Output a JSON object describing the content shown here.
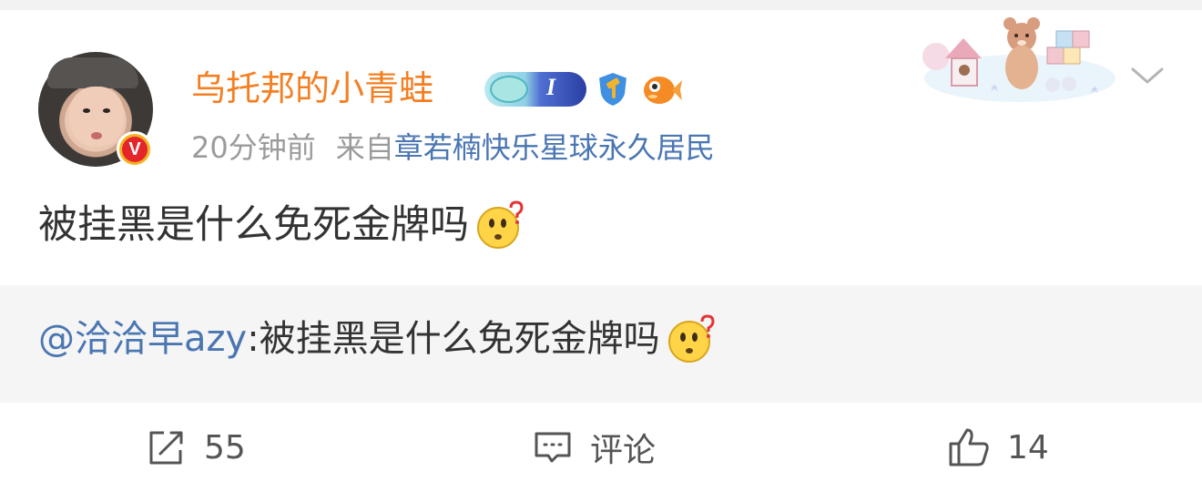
{
  "post": {
    "username": "乌托邦的小青蛙",
    "time": "20分钟前",
    "from_label": "来自",
    "source": "章若楠快乐星球永久居民",
    "text": "被挂黑是什么免死金牌吗",
    "badges": [
      "brain-level-badge",
      "shield-hammer-badge",
      "goldfish-badge"
    ],
    "verified_badge": "V",
    "level_badge_mark": "I"
  },
  "repost": {
    "mention": "@洽洽早azy",
    "separator": ":",
    "text": "被挂黑是什么免死金牌吗"
  },
  "actions": {
    "repost_count": "55",
    "comment_label": "评论",
    "like_count": "14"
  },
  "colors": {
    "username": "#f47f22",
    "link": "#4a76b2",
    "meta": "#9b9b9b",
    "text": "#333333",
    "repost_bg": "#f5f5f5"
  },
  "icons": {
    "post_emoji": "confused-face-emoji",
    "expand": "chevron-down-icon",
    "repost": "repost-icon",
    "comment": "comment-icon",
    "like": "thumbs-up-icon"
  }
}
